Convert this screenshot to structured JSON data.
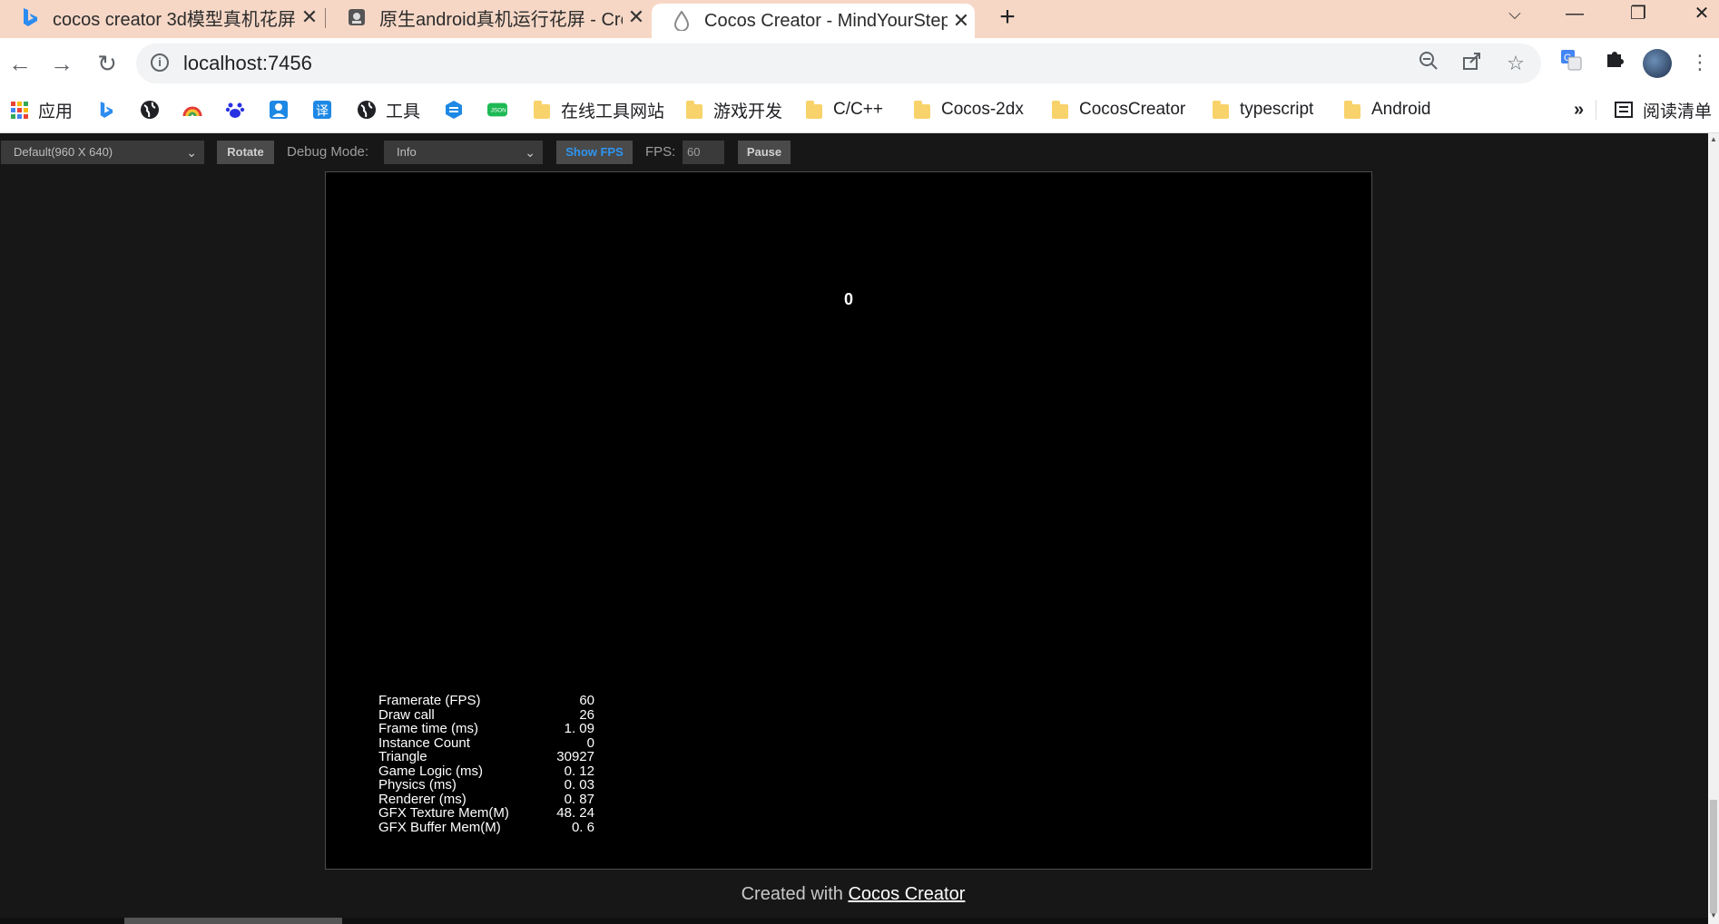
{
  "browser": {
    "tabs": [
      {
        "title": "cocos creator 3d模型真机花屏 -",
        "icon": "bing-icon"
      },
      {
        "title": "原生android真机运行花屏 - Cre",
        "icon": "cocos-forum-icon"
      },
      {
        "title": "Cocos Creator - MindYourStep",
        "icon": "cocos-icon",
        "active": true
      }
    ],
    "new_tab": "+",
    "window_controls": {
      "minimize": "—",
      "restore": "❐",
      "close": "✕"
    },
    "url": "localhost:7456",
    "bookmarks": [
      {
        "label": "应用",
        "icon": "apps-icon"
      },
      {
        "label": "",
        "icon": "bing-icon"
      },
      {
        "label": "",
        "icon": "globe-icon"
      },
      {
        "label": "",
        "icon": "rainbow-icon"
      },
      {
        "label": "",
        "icon": "baidu-icon"
      },
      {
        "label": "",
        "icon": "contact-icon"
      },
      {
        "label": "",
        "icon": "translate-icon"
      },
      {
        "label": "工具",
        "icon": "globe-icon"
      },
      {
        "label": "",
        "icon": "edge-icon"
      },
      {
        "label": "",
        "icon": "json-icon"
      },
      {
        "label": "在线工具网站",
        "icon": "folder-icon"
      },
      {
        "label": "游戏开发",
        "icon": "folder-icon"
      },
      {
        "label": "C/C++",
        "icon": "folder-icon"
      },
      {
        "label": "Cocos-2dx",
        "icon": "folder-icon"
      },
      {
        "label": "CocosCreator",
        "icon": "folder-icon"
      },
      {
        "label": "typescript",
        "icon": "folder-icon"
      },
      {
        "label": "Android",
        "icon": "folder-icon"
      }
    ],
    "bookmarks_more": "»",
    "reading_list": "阅读清单"
  },
  "preview_toolbar": {
    "resolution": "Default(960 X 640)",
    "rotate": "Rotate",
    "debug_mode_label": "Debug Mode:",
    "debug_mode_value": "Info",
    "show_fps": "Show FPS",
    "fps_label": "FPS:",
    "fps_value": "60",
    "pause": "Pause"
  },
  "game": {
    "score": "0",
    "stats": [
      {
        "key": "Framerate (FPS)",
        "value": "60"
      },
      {
        "key": "Draw call",
        "value": "26"
      },
      {
        "key": "Frame time (ms)",
        "value": "1. 09"
      },
      {
        "key": "Instance Count",
        "value": "0"
      },
      {
        "key": "Triangle",
        "value": "30927"
      },
      {
        "key": "Game Logic (ms)",
        "value": "0. 12"
      },
      {
        "key": "Physics (ms)",
        "value": "0. 03"
      },
      {
        "key": "Renderer (ms)",
        "value": "0. 87"
      },
      {
        "key": "GFX Texture Mem(M)",
        "value": "48. 24"
      },
      {
        "key": "GFX Buffer Mem(M)",
        "value": "0. 6"
      }
    ]
  },
  "footer": {
    "prefix": "Created with",
    "link": "Cocos Creator"
  },
  "colors": {
    "tabstrip": "#f6d7c6",
    "page_bg": "#171717",
    "show_fps_accent": "#2e95f0",
    "canvas_bg": "#000000"
  }
}
